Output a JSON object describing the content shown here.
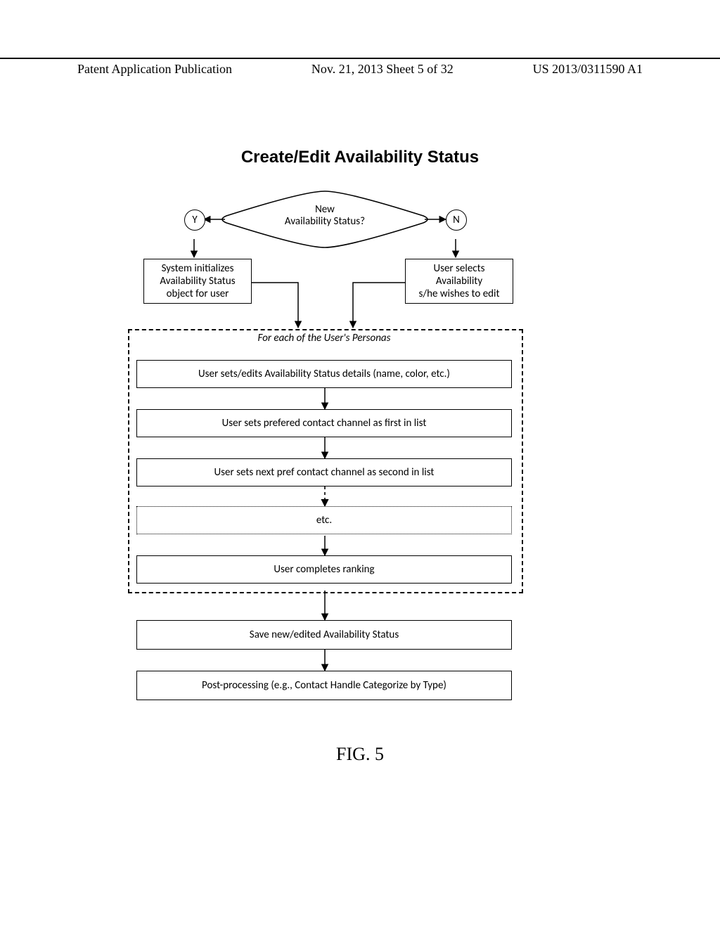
{
  "header": {
    "left": "Patent Application Publication",
    "mid": "Nov. 21, 2013  Sheet 5 of 32",
    "right": "US 2013/0311590 A1"
  },
  "title": "Create/Edit Availability Status",
  "decision": {
    "text_line1": "New",
    "text_line2": "Availability Status?",
    "yes_label": "Y",
    "no_label": "N"
  },
  "boxes": {
    "init": "System initializes\nAvailability Status\nobject for user",
    "select": "User selects\nAvailability\ns/he wishes to edit",
    "loop_label": "For each of the User's Personas",
    "step1": "User sets/edits Availability Status details (name, color, etc.)",
    "step2": "User sets prefered contact channel as first in list",
    "step3": "User sets next pref contact channel as second in list",
    "step4": "etc.",
    "step5": "User completes ranking",
    "save": "Save new/edited Availability Status",
    "post": "Post-processing (e.g., Contact Handle Categorize by Type)"
  },
  "figure_label": "FIG. 5",
  "chart_data": {
    "type": "flowchart",
    "title": "Create/Edit Availability Status",
    "nodes": [
      {
        "id": "decision",
        "type": "decision",
        "text": "New Availability Status?"
      },
      {
        "id": "yes",
        "type": "connector",
        "text": "Y"
      },
      {
        "id": "no",
        "type": "connector",
        "text": "N"
      },
      {
        "id": "init",
        "type": "process",
        "text": "System initializes Availability Status object for user"
      },
      {
        "id": "select",
        "type": "process",
        "text": "User selects Availability s/he wishes to edit"
      },
      {
        "id": "loop",
        "type": "loop",
        "text": "For each of the User's Personas",
        "contains": [
          "step1",
          "step2",
          "step3",
          "step4",
          "step5"
        ]
      },
      {
        "id": "step1",
        "type": "process",
        "text": "User sets/edits Availability Status details (name, color, etc.)"
      },
      {
        "id": "step2",
        "type": "process",
        "text": "User sets prefered contact channel as first in list"
      },
      {
        "id": "step3",
        "type": "process",
        "text": "User sets next pref contact channel as second in list"
      },
      {
        "id": "step4",
        "type": "process",
        "text": "etc.",
        "style": "dotted"
      },
      {
        "id": "step5",
        "type": "process",
        "text": "User completes ranking"
      },
      {
        "id": "save",
        "type": "process",
        "text": "Save new/edited Availability Status"
      },
      {
        "id": "post",
        "type": "process",
        "text": "Post-processing (e.g., Contact Handle Categorize by Type)"
      }
    ],
    "edges": [
      {
        "from": "decision",
        "to": "yes",
        "label": ""
      },
      {
        "from": "decision",
        "to": "no",
        "label": ""
      },
      {
        "from": "yes",
        "to": "init"
      },
      {
        "from": "no",
        "to": "select"
      },
      {
        "from": "init",
        "to": "loop"
      },
      {
        "from": "select",
        "to": "loop"
      },
      {
        "from": "step1",
        "to": "step2"
      },
      {
        "from": "step2",
        "to": "step3"
      },
      {
        "from": "step3",
        "to": "step4",
        "style": "dashed"
      },
      {
        "from": "step4",
        "to": "step5"
      },
      {
        "from": "loop",
        "to": "save"
      },
      {
        "from": "save",
        "to": "post"
      }
    ]
  }
}
